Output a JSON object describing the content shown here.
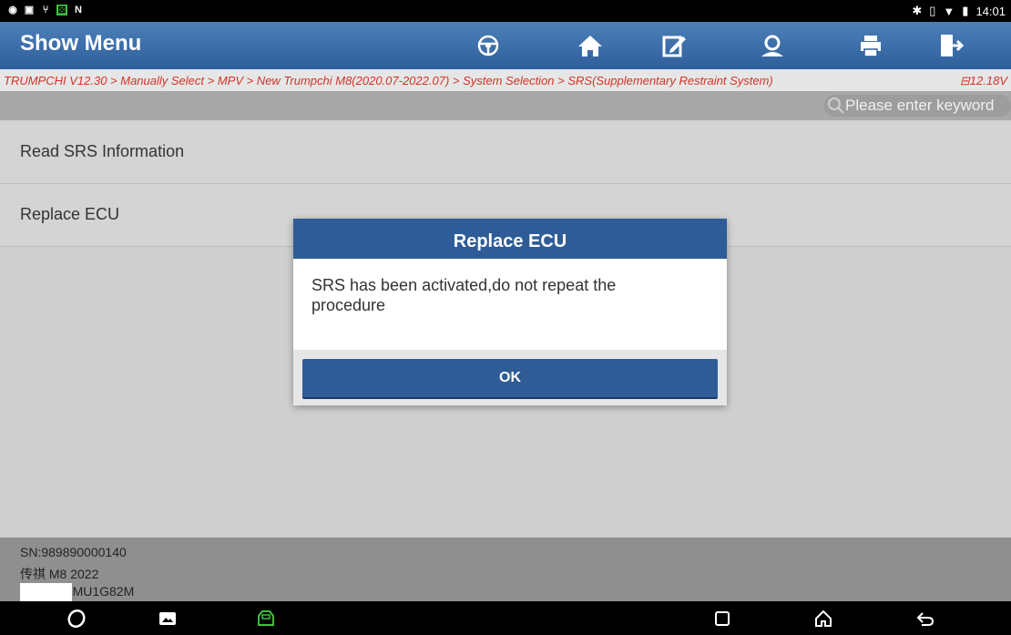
{
  "status_bar": {
    "time": "14:01"
  },
  "header": {
    "title": "Show Menu",
    "icons": [
      "steering-wheel-icon",
      "home-icon",
      "edit-icon",
      "profile-icon",
      "print-icon",
      "exit-icon"
    ]
  },
  "breadcrumb": {
    "path": "TRUMPCHI V12.30 > Manually Select > MPV > New Trumpchi M8(2020.07-2022.07) > System Selection > SRS(Supplementary Restraint System)",
    "voltage": "12.18V"
  },
  "search": {
    "placeholder": "Please enter keyword"
  },
  "menu": {
    "items": [
      {
        "label": "Read SRS Information"
      },
      {
        "label": "Replace ECU"
      }
    ]
  },
  "dialog": {
    "title": "Replace ECU",
    "message": "SRS has been activated,do not repeat the procedure",
    "ok_label": "OK"
  },
  "footer": {
    "sn": "SN:989890000140",
    "model": "传祺 M8 2022",
    "vin": "VIN LMGMU1G82M"
  },
  "colors": {
    "header": "#2e5f9c",
    "breadcrumb_text": "#d03427",
    "dialog_header": "#2f5c96",
    "vci_icon": "#3fbf3f"
  }
}
